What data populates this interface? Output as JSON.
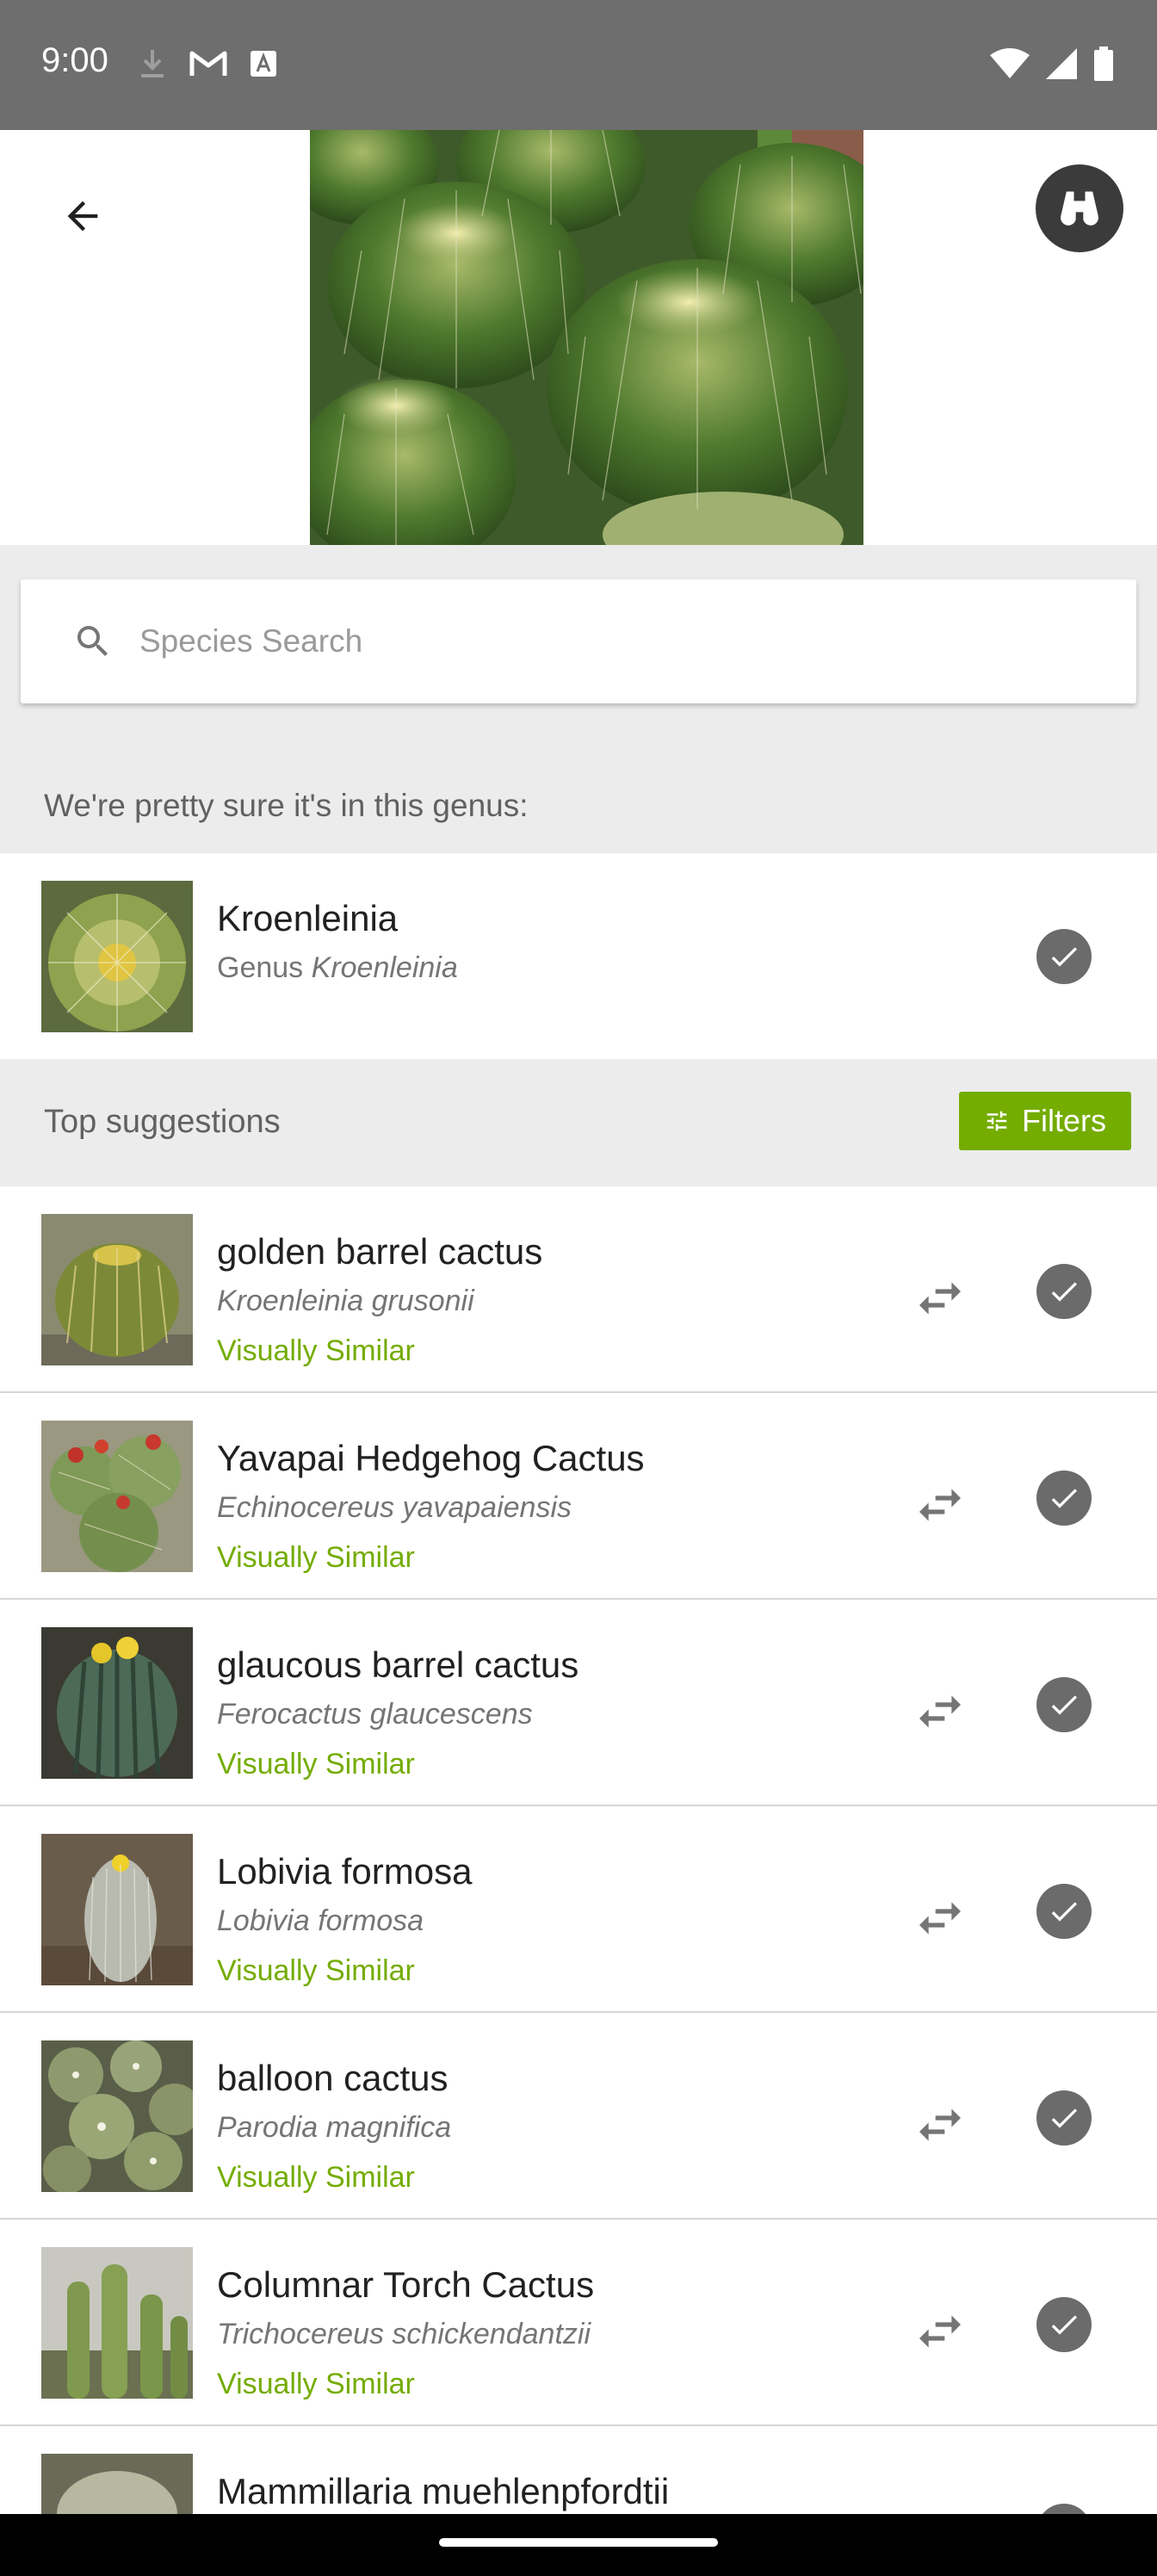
{
  "status_bar": {
    "time": "9:00",
    "left_icons": [
      "download-icon",
      "gmail-icon",
      "text-icon"
    ],
    "right_icons": [
      "wifi-icon",
      "signal-icon",
      "battery-icon"
    ]
  },
  "header": {
    "back_icon": "arrow-back-icon",
    "binoculars_icon": "binoculars-icon",
    "photo_subject": "cactus-photo"
  },
  "search": {
    "placeholder": "Species Search",
    "value": ""
  },
  "genus_section": {
    "prompt": "We're pretty sure it's in this genus:",
    "name": "Kroenleinia",
    "rank": "Genus",
    "scientific": "Kroenleinia"
  },
  "suggestions_header": {
    "label": "Top suggestions",
    "filters_label": "Filters"
  },
  "suggestions": [
    {
      "common": "golden barrel cactus",
      "scientific": "Kroenleinia grusonii",
      "tag": "Visually Similar"
    },
    {
      "common": "Yavapai Hedgehog Cactus",
      "scientific": "Echinocereus yavapaiensis",
      "tag": "Visually Similar"
    },
    {
      "common": "glaucous barrel cactus",
      "scientific": "Ferocactus glaucescens",
      "tag": "Visually Similar"
    },
    {
      "common": "Lobivia formosa",
      "scientific": "Lobivia formosa",
      "tag": "Visually Similar"
    },
    {
      "common": "balloon cactus",
      "scientific": "Parodia magnifica",
      "tag": "Visually Similar"
    },
    {
      "common": "Columnar Torch Cactus",
      "scientific": "Trichocereus schickendantzii",
      "tag": "Visually Similar"
    },
    {
      "common": "Mammillaria muehlenpfordtii",
      "scientific": "",
      "tag": ""
    }
  ],
  "colors": {
    "accent": "#74ac00",
    "status_bar": "#6e6e6e",
    "section_bg": "#ececec"
  }
}
